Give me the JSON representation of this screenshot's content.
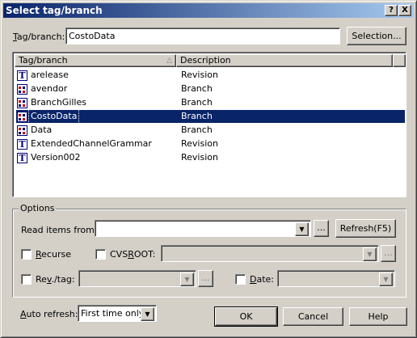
{
  "window": {
    "title": "Select tag/branch",
    "help_btn": "?",
    "close_btn": "X"
  },
  "tag_field": {
    "label_key": "T",
    "label_rest": "ag/branch:",
    "value": "CostoData"
  },
  "selection_button": "Selection...",
  "list": {
    "columns": [
      "Tag/branch",
      "Description"
    ],
    "rows": [
      {
        "name": "arelease",
        "desc": "Revision",
        "icon": "revision-icon"
      },
      {
        "name": "avendor",
        "desc": "Branch",
        "icon": "branch-icon"
      },
      {
        "name": "BranchGilles",
        "desc": "Branch",
        "icon": "branch-icon"
      },
      {
        "name": "CostoData",
        "desc": "Branch",
        "icon": "branch-icon",
        "selected": true
      },
      {
        "name": "Data",
        "desc": "Branch",
        "icon": "branch-icon"
      },
      {
        "name": "ExtendedChannelGrammar",
        "desc": "Revision",
        "icon": "revision-icon"
      },
      {
        "name": "Version002",
        "desc": "Revision",
        "icon": "revision-icon"
      }
    ]
  },
  "options": {
    "title": "Options",
    "read_items_from_label": "Read items from:",
    "read_items_value": "",
    "ellipsis": "...",
    "refresh_button": "Refresh(F5)",
    "recurse_key": "R",
    "recurse_rest": "ecurse",
    "cvsroot_pre": "CVS",
    "cvsroot_key": "R",
    "cvsroot_rest": "OOT:",
    "revtag_pre": "Re",
    "revtag_key": "v",
    "revtag_rest": "./tag:",
    "date_key": "D",
    "date_rest": "ate:"
  },
  "auto_refresh": {
    "label_key": "A",
    "label_rest": "uto refresh:",
    "value": "First time only"
  },
  "buttons": {
    "ok": "OK",
    "cancel": "Cancel",
    "help": "Help"
  },
  "colors": {
    "selection": "#0a246a",
    "face": "#d4d0c8"
  }
}
